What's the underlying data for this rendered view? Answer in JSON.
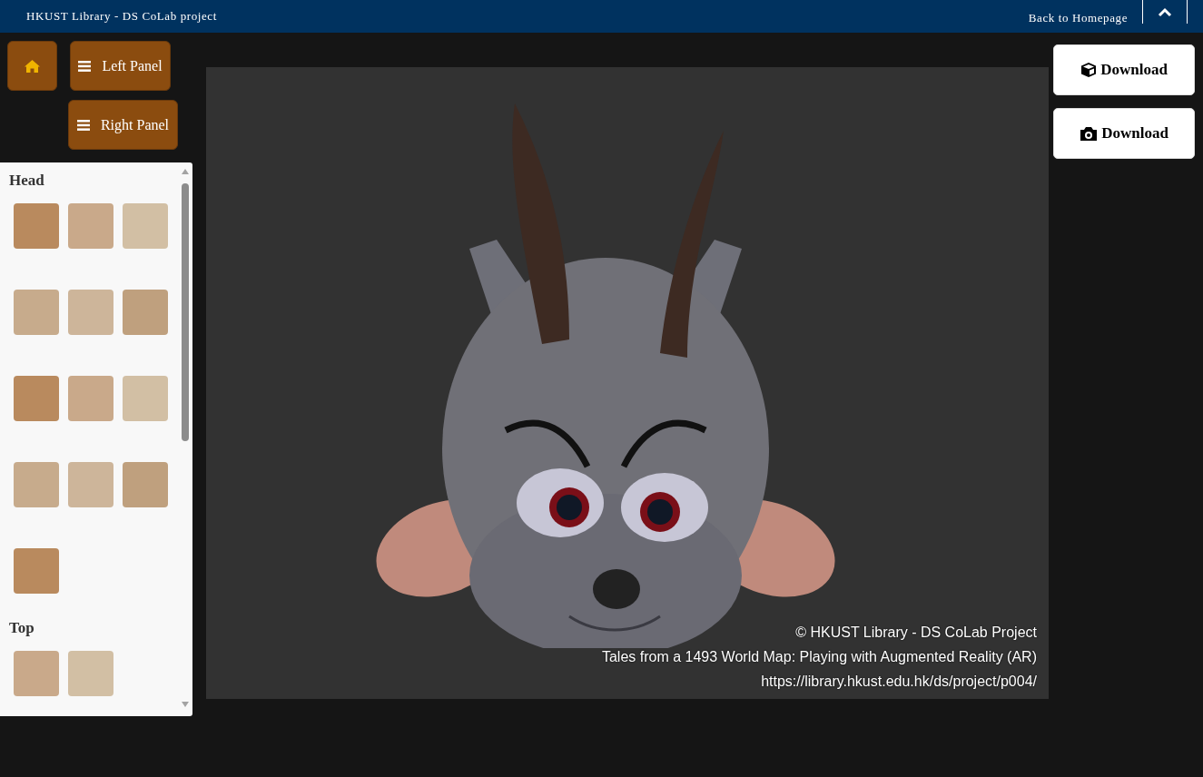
{
  "header": {
    "title": "HKUST Library - DS CoLab project",
    "back_link": "Back to Homepage"
  },
  "controls": {
    "left_panel": "Left Panel",
    "right_panel": "Right Panel"
  },
  "panel": {
    "sections": [
      {
        "title": "Head",
        "items": [
          {
            "kind": "image"
          },
          {
            "kind": "image"
          },
          {
            "kind": "image"
          },
          {
            "kind": "image"
          },
          {
            "kind": "image"
          },
          {
            "kind": "image"
          },
          {
            "kind": "image"
          },
          {
            "kind": "image"
          },
          {
            "kind": "image"
          },
          {
            "kind": "image"
          },
          {
            "kind": "image"
          },
          {
            "kind": "image"
          },
          {
            "kind": "image"
          }
        ]
      },
      {
        "title": "Top",
        "items": [
          {
            "kind": "image"
          },
          {
            "kind": "image"
          }
        ]
      }
    ]
  },
  "viewer": {
    "credits": [
      "© HKUST Library - DS CoLab Project",
      "Tales from a 1493 World Map: Playing with Augmented Reality (AR)",
      "https://library.hkust.edu.hk/ds/project/p004/"
    ]
  },
  "downloads": [
    {
      "kind": "model",
      "label": "Download"
    },
    {
      "kind": "photo",
      "label": "Download"
    }
  ]
}
